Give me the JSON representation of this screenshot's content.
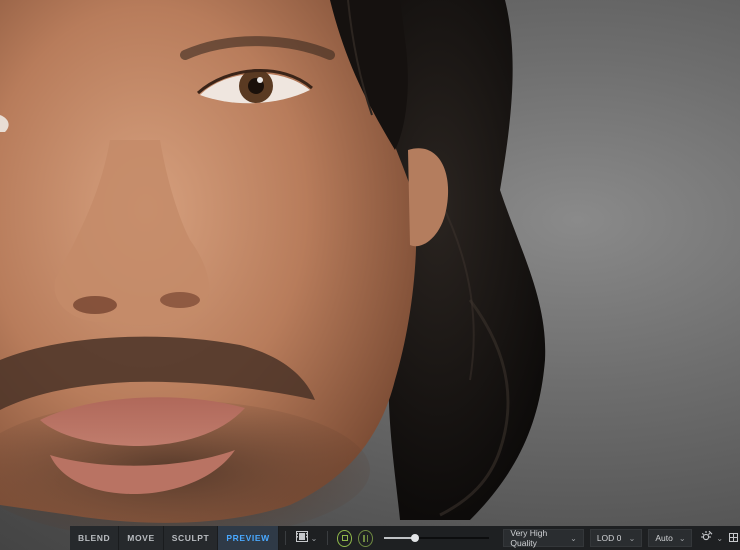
{
  "toolbar": {
    "modes": [
      {
        "label": "BLEND",
        "active": false
      },
      {
        "label": "MOVE",
        "active": false
      },
      {
        "label": "SCULPT",
        "active": false
      },
      {
        "label": "PREVIEW",
        "active": true
      }
    ],
    "camera_icon": "film-camera-icon",
    "stop_icon": "stop-icon",
    "pause_icon": "pause-icon",
    "timeline_progress": 0.29,
    "quality": "Very High Quality",
    "lod": "LOD 0",
    "auto": "Auto",
    "lighting_icon": "light-settings-icon",
    "accent_color": "#49a8ff",
    "play_color": "#8fb84a"
  }
}
